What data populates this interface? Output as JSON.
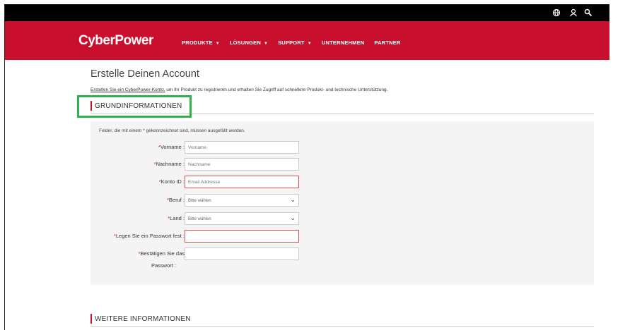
{
  "header": {
    "icons": [
      "globe-icon",
      "user-icon",
      "search-icon"
    ]
  },
  "nav": {
    "logo": "CyberPower",
    "items": [
      {
        "label": "PRODUKTE",
        "caret": "▼"
      },
      {
        "label": "LÖSUNGEN",
        "caret": "▼"
      },
      {
        "label": "SUPPORT",
        "caret": "▼"
      },
      {
        "label": "UNTERNEHMEN",
        "caret": ""
      },
      {
        "label": "PARTNER",
        "caret": ""
      }
    ]
  },
  "page": {
    "title": "Erstelle Deinen Account",
    "intro_link": "Erstellen Sie ein CyberPower-Konto,",
    "intro_rest": " um Ihr Produkt zu registrieren und erhalten Sie Zugriff auf schnellere Produkt- und technische Unterstützung."
  },
  "sections": {
    "basic": "GRUNDINFORMATIONEN",
    "more": "WEITERE INFORMATIONEN"
  },
  "form": {
    "note": "Felder, die mit einem * gekennzeichnet sind, müssen ausgefüllt werden.",
    "required_mark": "*",
    "fields": {
      "vorname": {
        "label": "Vorname :",
        "placeholder": "Vorname",
        "value": ""
      },
      "nachname": {
        "label": "Nachname :",
        "placeholder": "Nachname",
        "value": ""
      },
      "konto": {
        "label": "Konto ID :",
        "placeholder": "Email Addresse",
        "value": ""
      },
      "beruf": {
        "label": "Beruf :",
        "selected": "Bitte wählen"
      },
      "land": {
        "label": "Land :",
        "selected": "Bitte wählen"
      },
      "passwort": {
        "label": "Legen Sie ein Passwort fest :",
        "placeholder": "",
        "value": ""
      },
      "bestaetigen": {
        "label_line1": "Bestätigen Sie das",
        "label_line2": "Passwort :",
        "placeholder": "",
        "value": ""
      }
    }
  },
  "colors": {
    "brand_red": "#c8102e",
    "highlight_green": "#2db34a",
    "error_red": "#d9534f"
  }
}
